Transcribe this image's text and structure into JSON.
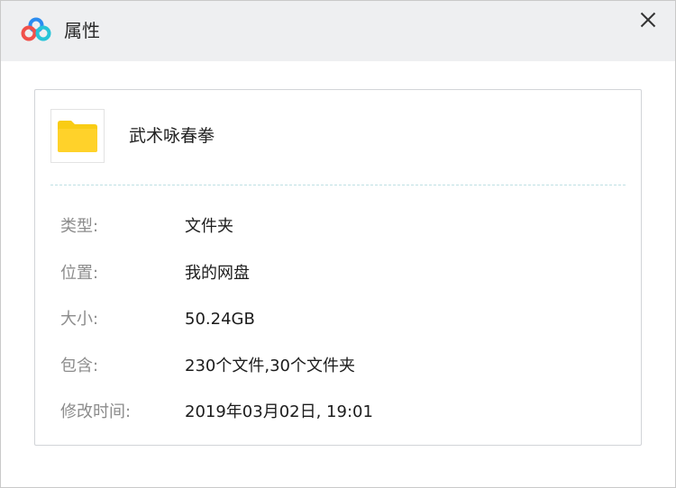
{
  "window": {
    "title": "属性",
    "icons": {
      "app": "baidu-netdisk-logo-icon",
      "close": "close-icon"
    }
  },
  "file": {
    "icon": "folder-icon",
    "icon_color": "#f9cc14",
    "name": "武术咏春拳"
  },
  "properties": [
    {
      "label": "类型:",
      "value": "文件夹"
    },
    {
      "label": "位置:",
      "value": "我的网盘"
    },
    {
      "label": "大小:",
      "value": "50.24GB"
    },
    {
      "label": "包含:",
      "value": "230个文件,30个文件夹"
    },
    {
      "label": "修改时间:",
      "value": "2019年03月02日, 19:01"
    }
  ],
  "colors": {
    "titlebar_bg": "#eeeff1",
    "logo_blue": "#2a8cf0",
    "logo_red": "#f0504a",
    "logo_cyan": "#27c4d8"
  }
}
